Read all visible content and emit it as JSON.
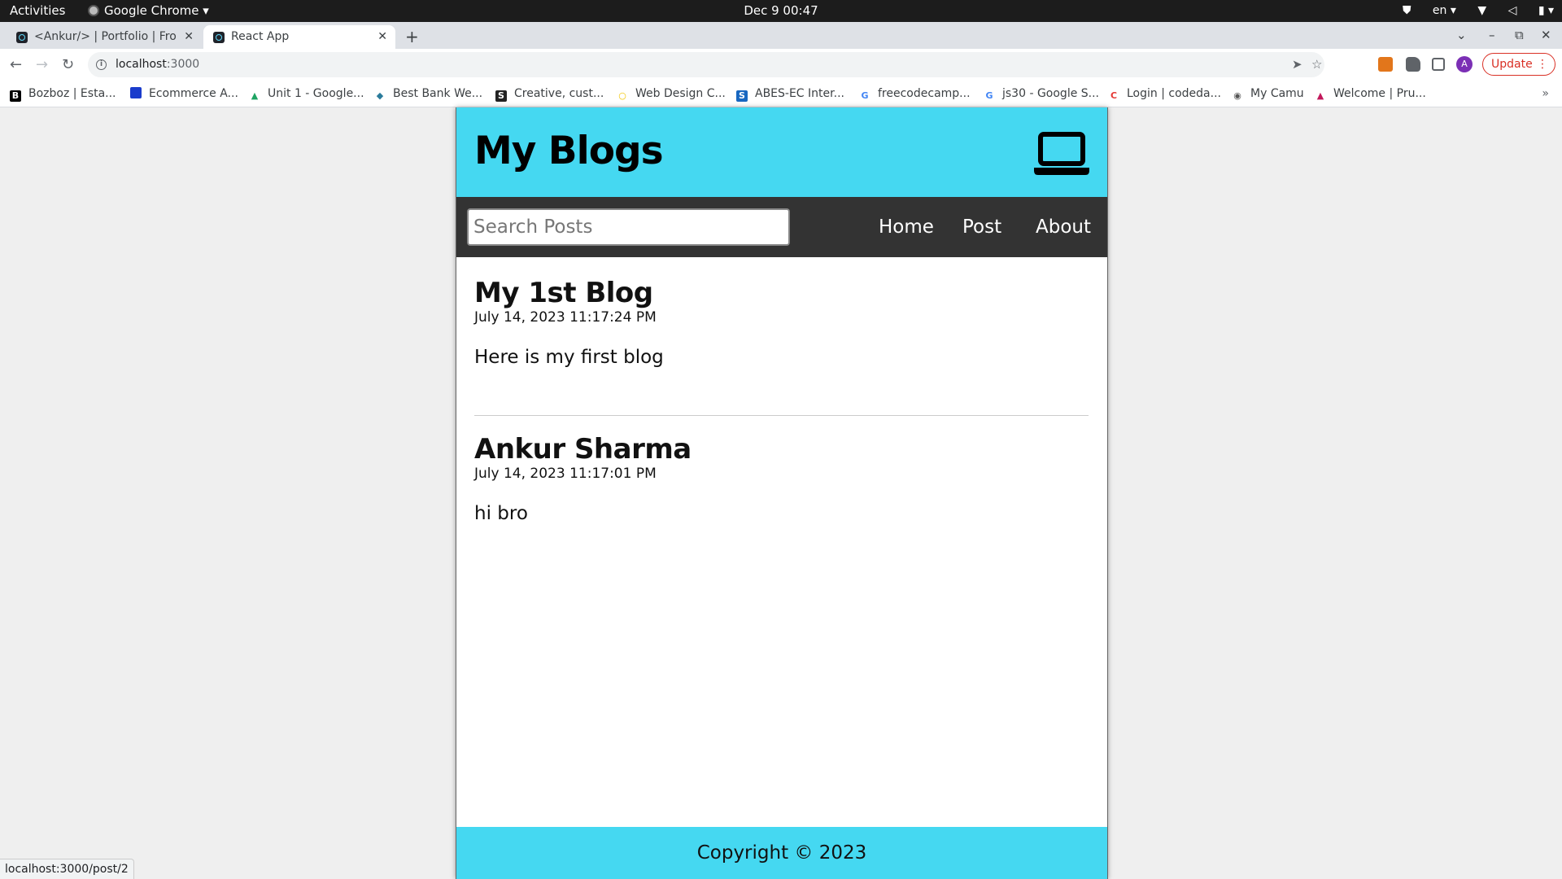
{
  "os": {
    "activities_label": "Activities",
    "app_menu_label": "Google Chrome ▾",
    "clock": "Dec 9  00:47",
    "language": "en​ ▾"
  },
  "browser": {
    "tabs": [
      {
        "title": "<Ankur/> | Portfolio | Fron",
        "active": false
      },
      {
        "title": "React App",
        "active": true
      }
    ],
    "new_tab_label": "+",
    "url_host": "localhost",
    "url_port": ":3000",
    "update_label": "Update",
    "avatar_initial": "A",
    "bookmarks": [
      {
        "label": "Bozboz | Esta...",
        "icon": "B",
        "color": "#000000"
      },
      {
        "label": "Ecommerce A...",
        "icon": "",
        "color": "#1a3ccc"
      },
      {
        "label": "Unit 1 - Google...",
        "icon": "▲",
        "color": "#1fa463"
      },
      {
        "label": "Best Bank We...",
        "icon": "◆",
        "color": "#2a7b9b"
      },
      {
        "label": "Creative, cust...",
        "icon": "S",
        "color": "#222222"
      },
      {
        "label": "Web Design C...",
        "icon": "○",
        "color": "#f2c500"
      },
      {
        "label": "ABES-EC Inter...",
        "icon": "S",
        "color": "#1867c0"
      },
      {
        "label": "freecodecamp...",
        "icon": "G",
        "color": "#4285f4"
      },
      {
        "label": "js30 - Google S...",
        "icon": "G",
        "color": "#4285f4"
      },
      {
        "label": "Login | codeda...",
        "icon": "C",
        "color": "#e53935"
      },
      {
        "label": "My Camu",
        "icon": "◉",
        "color": "#555555"
      },
      {
        "label": "Welcome | Pru...",
        "icon": "▲",
        "color": "#c2185b"
      }
    ],
    "status_url": "localhost:3000/post/2"
  },
  "app": {
    "title": "My Blogs",
    "search_placeholder": "Search Posts",
    "nav": [
      "Home",
      "Post",
      "About"
    ],
    "posts": [
      {
        "title": "My 1st Blog",
        "datetime": "July 14, 2023 11:17:24 PM",
        "body": "Here is my first blog"
      },
      {
        "title": "Ankur Sharma",
        "datetime": "July 14, 2023 11:17:01 PM",
        "body": "hi bro"
      }
    ],
    "footer": "Copyright © 2023",
    "accent_color": "#45d8f1",
    "nav_color": "#333333"
  }
}
